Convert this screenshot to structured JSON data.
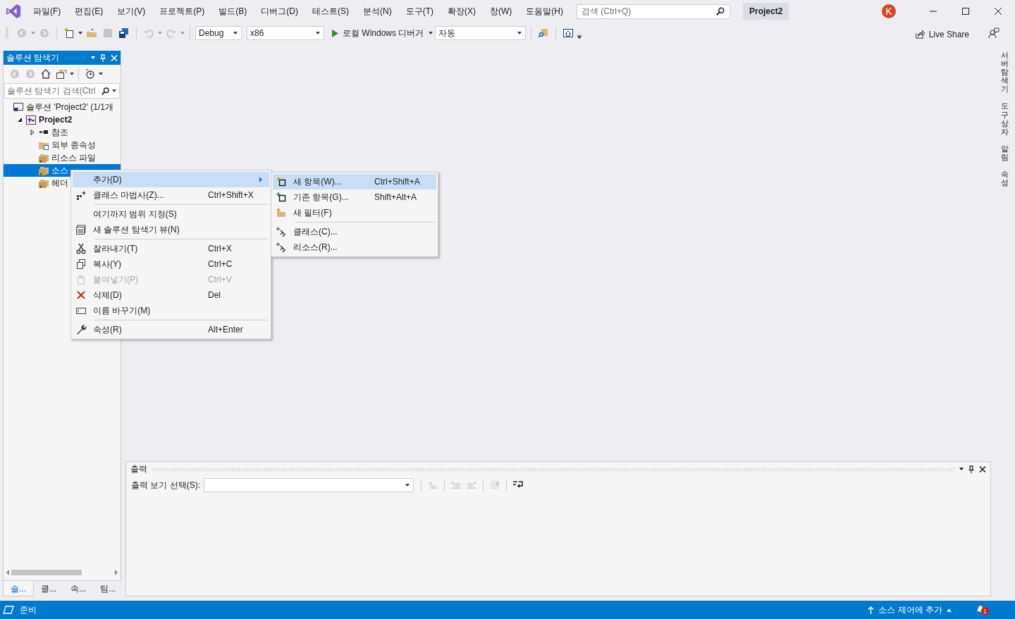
{
  "title_bar": {
    "menu": [
      "파일(F)",
      "편집(E)",
      "보기(V)",
      "프로젝트(P)",
      "빌드(B)",
      "디버그(D)",
      "테스트(S)",
      "분석(N)",
      "도구(T)",
      "확장(X)",
      "창(W)",
      "도움말(H)"
    ],
    "search": {
      "placeholder": "검색 (Ctrl+Q)"
    },
    "project_name": "Project2",
    "avatar": "K"
  },
  "toolbar": {
    "configuration": "Debug",
    "platform": "x86",
    "run_label": "로컬 Windows 디버거",
    "run_mode": "자동",
    "live_share": "Live Share"
  },
  "solution_explorer": {
    "title": "솔루션 탐색기",
    "search": {
      "placeholder": "솔루션 탐색기 검색(Ctrl"
    },
    "tree": [
      {
        "label": "솔루션 'Project2' (1/1개",
        "kind": "solution",
        "selected": false,
        "children": [
          {
            "label": "Project2",
            "kind": "project",
            "expanded": true,
            "selected": false,
            "children": [
              {
                "label": "참조",
                "kind": "references",
                "expanded": false,
                "selected": false
              },
              {
                "label": "외부 종속성",
                "kind": "external",
                "selected": false
              },
              {
                "label": "리소스 파일",
                "kind": "filter",
                "selected": false
              },
              {
                "label": "소스",
                "kind": "filter",
                "selected": true
              },
              {
                "label": "헤더",
                "kind": "filter",
                "selected": false
              }
            ]
          }
        ]
      }
    ],
    "tabs": [
      {
        "label": "솔...",
        "selected": true
      },
      {
        "label": "클...",
        "selected": false
      },
      {
        "label": "속...",
        "selected": false
      },
      {
        "label": "팀...",
        "selected": false
      }
    ]
  },
  "context_menu": {
    "items": [
      {
        "kind": "item",
        "label": "추가(D)",
        "selected": true,
        "submenu": true,
        "disabled": false
      },
      {
        "kind": "item",
        "label": "클래스 마법사(Z)...",
        "shortcut": "Ctrl+Shift+X",
        "selected": false,
        "submenu": false,
        "disabled": false
      },
      {
        "kind": "separator"
      },
      {
        "kind": "item",
        "label": "여기까지 범위 지정(S)",
        "selected": false,
        "submenu": false,
        "disabled": false
      },
      {
        "kind": "item",
        "label": "새 솔루션 탐색기 뷰(N)",
        "selected": false,
        "submenu": false,
        "disabled": false
      },
      {
        "kind": "separator"
      },
      {
        "kind": "item",
        "label": "잘라내기(T)",
        "shortcut": "Ctrl+X",
        "selected": false,
        "submenu": false,
        "disabled": false
      },
      {
        "kind": "item",
        "label": "복사(Y)",
        "shortcut": "Ctrl+C",
        "selected": false,
        "submenu": false,
        "disabled": false
      },
      {
        "kind": "item",
        "label": "붙여넣기(P)",
        "shortcut": "Ctrl+V",
        "selected": false,
        "submenu": false,
        "disabled": true
      },
      {
        "kind": "item",
        "label": "삭제(D)",
        "shortcut": "Del",
        "selected": false,
        "submenu": false,
        "disabled": false
      },
      {
        "kind": "item",
        "label": "이름 바꾸기(M)",
        "selected": false,
        "submenu": false,
        "disabled": false
      },
      {
        "kind": "separator"
      },
      {
        "kind": "item",
        "label": "속성(R)",
        "shortcut": "Alt+Enter",
        "selected": false,
        "submenu": false,
        "disabled": false
      }
    ]
  },
  "submenu": {
    "items": [
      {
        "kind": "item",
        "label": "새 항목(W)...",
        "shortcut": "Ctrl+Shift+A",
        "selected": true
      },
      {
        "kind": "item",
        "label": "기존 항목(G)...",
        "shortcut": "Shift+Alt+A",
        "selected": false
      },
      {
        "kind": "item",
        "label": "새 필터(F)",
        "selected": false
      },
      {
        "kind": "separator"
      },
      {
        "kind": "item",
        "label": "클래스(C)...",
        "selected": false
      },
      {
        "kind": "item",
        "label": "리소스(R)...",
        "selected": false
      }
    ]
  },
  "right_tabs": [
    "서버 탐색기",
    "도구 상자",
    "알림",
    "속성"
  ],
  "output": {
    "title": "출력",
    "select_label": "출력 보기 선택(S):"
  },
  "status_bar": {
    "text": "준비",
    "source_control": "소스 제어에 추가",
    "notification_count": "1"
  }
}
